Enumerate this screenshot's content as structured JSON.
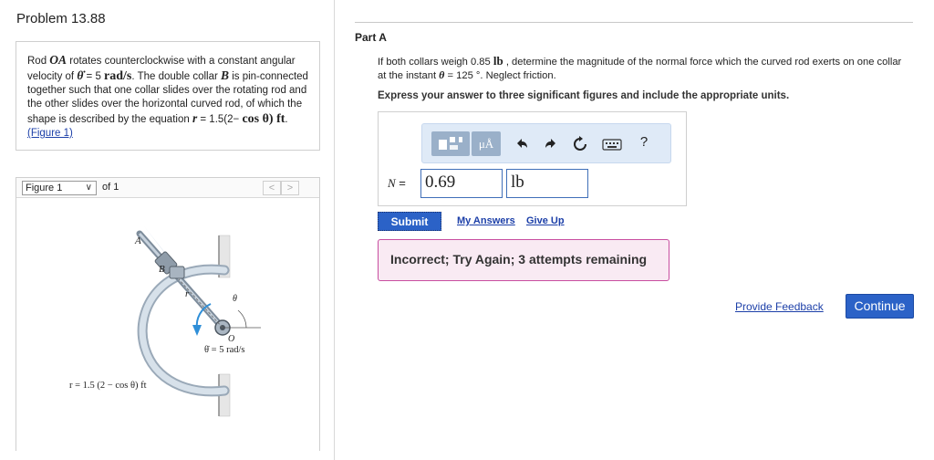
{
  "problem": {
    "title": "Problem 13.88",
    "text_1": "Rod ",
    "rod_name": "OA",
    "text_2": " rotates counterclockwise with a constant angular velocity of ",
    "theta_dot": "θ̇",
    "text_3": " = 5 ",
    "unit_rad_s": "rad/s",
    "text_4": ". The double collar ",
    "collar_name": "B",
    "text_5": " is pin-connected together such that one collar slides over the rotating rod and the other slides over the horizontal curved rod, of which the shape is described by the equation ",
    "r_sym": "r",
    "text_6": " = 1.5(2− ",
    "cos_theta": "cos θ)",
    "ft": " ft",
    "text_7": ". ",
    "figure_link": "(Figure 1)"
  },
  "figure_panel": {
    "select_value": "Figure 1",
    "of_label": "of 1",
    "prev_label": "<",
    "next_label": ">",
    "labels": {
      "a": "A",
      "b": "B",
      "r": "r",
      "theta": "θ",
      "o": "O",
      "omega": "θ̇ = 5 rad/s",
      "equation": "r = 1.5 (2 − cos θ) ft"
    }
  },
  "part": {
    "title": "Part A",
    "q_1": "If both collars weigh 0.85 ",
    "q_lb": "lb",
    "q_2": " , determine the magnitude of the normal force which the curved rod exerts on one collar at the instant ",
    "q_theta": "θ",
    "q_3": " = 125 °. Neglect friction.",
    "instruction": "Express your answer to three significant figures and include the appropriate units.",
    "toolbar": {
      "units_label": "μÅ",
      "help_label": "?"
    },
    "answer_label": "N",
    "answer_eq": " =",
    "answer_value": "0.69",
    "answer_units": "lb",
    "submit_label": "Submit",
    "my_answers_label": "My Answers",
    "give_up_label": "Give Up",
    "feedback": "Incorrect; Try Again; 3 attempts remaining"
  },
  "footer": {
    "provide_feedback_label": "Provide Feedback",
    "continue_label": "Continue"
  },
  "colors": {
    "accent": "#2b62c7",
    "toolbar_bg": "#dfeaf7",
    "feedback_bg": "#f9eaf3",
    "feedback_border": "#c84ea0",
    "rod": "#bcc9d6"
  }
}
